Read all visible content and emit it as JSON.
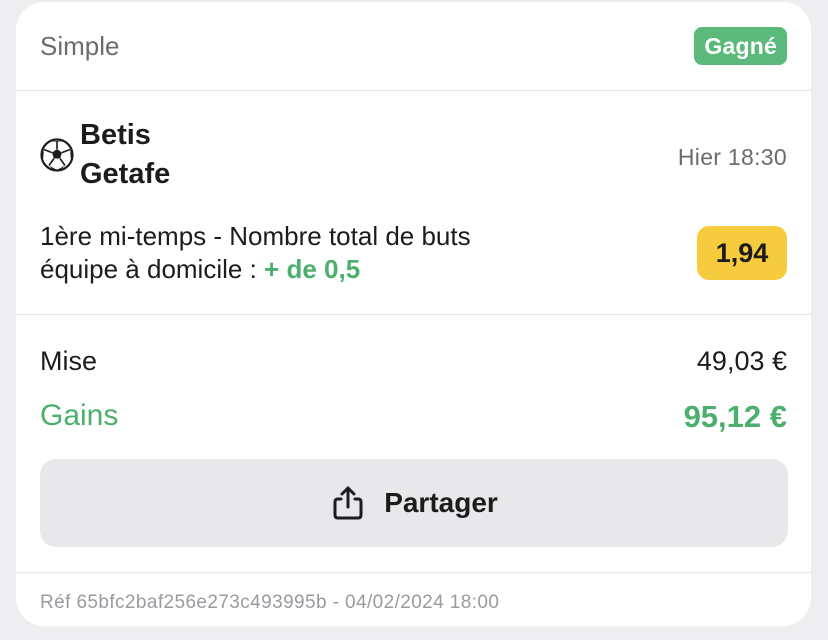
{
  "header": {
    "bet_type": "Simple",
    "status_badge": "Gagné"
  },
  "match": {
    "icon": "football-icon",
    "home_team": "Betis",
    "away_team": "Getafe",
    "time": "Hier 18:30"
  },
  "selection": {
    "market_line1": "1ère mi-temps - Nombre total de buts",
    "market_line2_prefix": "équipe à domicile : ",
    "pick": "+ de 0,5",
    "odds": "1,94"
  },
  "summary": {
    "stake_label": "Mise",
    "stake_value": "49,03 €",
    "gains_label": "Gains",
    "gains_value": "95,12 €"
  },
  "actions": {
    "share_label": "Partager",
    "share_icon": "share-icon"
  },
  "footer": {
    "reference": "Réf 65bfc2baf256e273c493995b - 04/02/2024 18:00"
  },
  "colors": {
    "win_green": "#5bb97b",
    "gain_green": "#4caf6e",
    "odds_yellow": "#f6cb3d",
    "button_gray": "#e8e8ea"
  }
}
